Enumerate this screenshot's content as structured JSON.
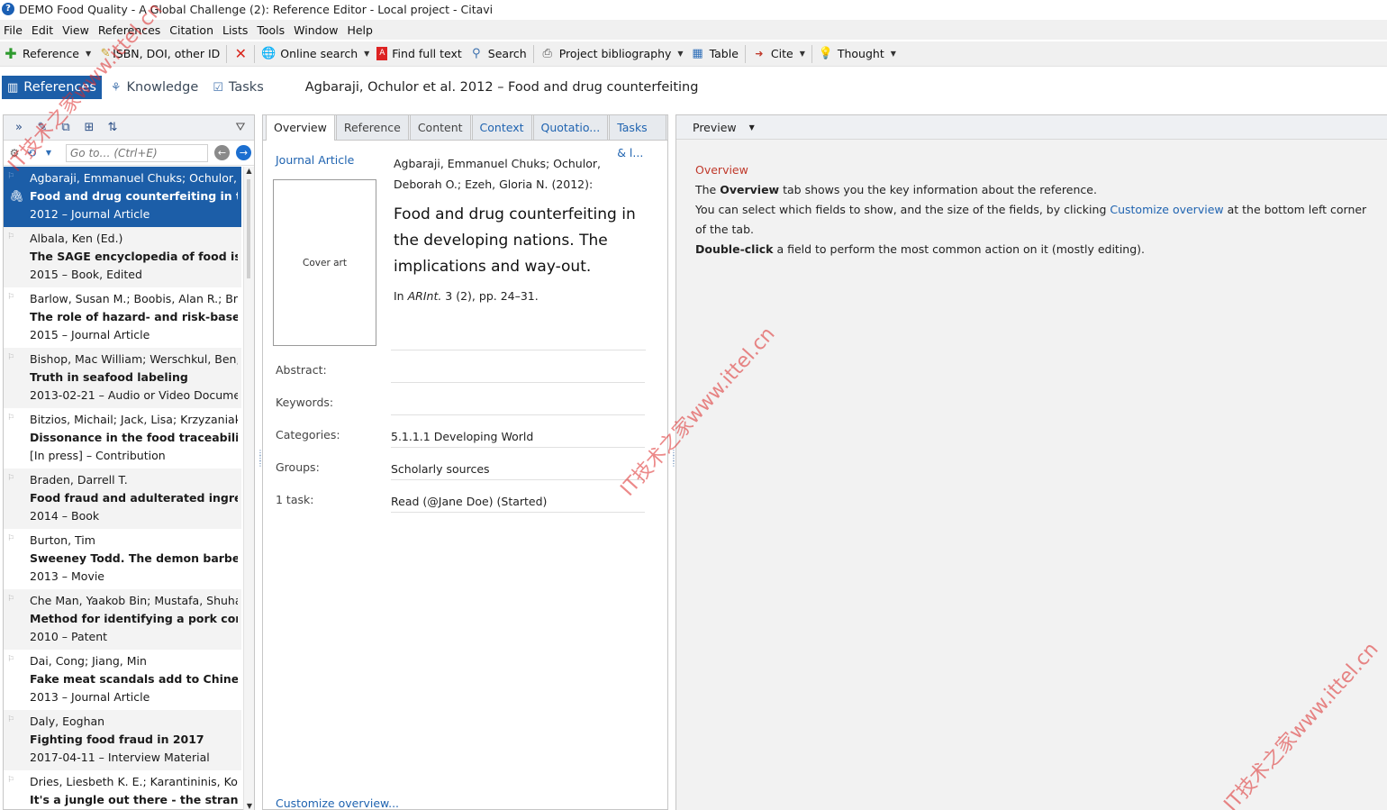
{
  "window": {
    "title": "DEMO Food Quality - A Global Challenge (2): Reference Editor - Local project - Citavi"
  },
  "menu": [
    "File",
    "Edit",
    "View",
    "References",
    "Citation",
    "Lists",
    "Tools",
    "Window",
    "Help"
  ],
  "toolbar": {
    "reference_label": "Reference",
    "isbn_label": "ISBN, DOI, other ID",
    "online_search_label": "Online search",
    "find_full_text_label": "Find full text",
    "search_label": "Search",
    "project_bibliography_label": "Project bibliography",
    "table_label": "Table",
    "cite_label": "Cite",
    "thought_label": "Thought"
  },
  "nav": {
    "references_label": "References",
    "knowledge_label": "Knowledge",
    "tasks_label": "Tasks",
    "current_title": "Agbaraji, Ochulor et al. 2012 – Food and drug counterfeiting"
  },
  "left": {
    "goto_placeholder": "Go to… (Ctrl+E)",
    "references": [
      {
        "authors": "Agbaraji, Emmanuel Chuks; Ochulor, D",
        "title": "Food and drug counterfeiting in the d",
        "meta": "2012 – Journal Article",
        "selected": true
      },
      {
        "authors": "Albala, Ken (Ed.)",
        "title": "The SAGE encyclopedia of food issues",
        "meta": "2015 – Book, Edited"
      },
      {
        "authors": "Barlow, Susan M.; Boobis, Alan R.; Brid",
        "title": "The role of hazard- and risk-based ap",
        "meta": "2015 – Journal Article"
      },
      {
        "authors": "Bishop, Mac William; Werschkul, Ben;",
        "title": "Truth in seafood labeling",
        "meta": "2013-02-21 – Audio or Video Docume"
      },
      {
        "authors": "Bitzios, Michail; Jack, Lisa; Krzyzaniak, S",
        "title": "Dissonance in the food traceability re",
        "meta": "[In press] – Contribution"
      },
      {
        "authors": "Braden, Darrell T.",
        "title": "Food fraud and adulterated ingredien",
        "meta": "2014 – Book"
      },
      {
        "authors": "Burton, Tim",
        "title": "Sweeney Todd. The demon barber of",
        "meta": "2013 – Movie"
      },
      {
        "authors": "Che Man, Yaakob Bin; Mustafa, Shuhai",
        "title": "Method for identifying a pork content",
        "meta": "2010 – Patent"
      },
      {
        "authors": "Dai, Cong; Jiang, Min",
        "title": "Fake meat scandals add to Chinese fo",
        "meta": "2013 – Journal Article"
      },
      {
        "authors": "Daly, Eoghan",
        "title": "Fighting food fraud in 2017",
        "meta": "2017-04-11 – Interview Material"
      },
      {
        "authors": "Dries, Liesbeth K. E.; Karantininis, Konst",
        "title": "It's a jungle out there - the strange ani",
        "meta": ""
      }
    ]
  },
  "middle": {
    "tabs": [
      "Overview",
      "Reference",
      "Content",
      "Context",
      "Quotatio...",
      "Tasks & l..."
    ],
    "ref_type": "Journal Article",
    "cover_art": "Cover art",
    "authors": "Agbaraji, Emmanuel Chuks; Ochulor, Deborah O.; Ezeh, Gloria N. (2012):",
    "title": "Food and drug counterfeiting in the developing nations. The implications and way-out.",
    "source_prefix": "In ",
    "source_journal": "ARInt.",
    "source_rest": " 3 (2), pp. 24–31.",
    "fields": [
      {
        "label": "Abstract:",
        "value": ""
      },
      {
        "label": "Keywords:",
        "value": ""
      },
      {
        "label": "Categories:",
        "value": "5.1.1.1 Developing World"
      },
      {
        "label": "Groups:",
        "value": "Scholarly sources"
      },
      {
        "label": "1 task:",
        "value": "Read (@Jane Doe) (Started)"
      }
    ],
    "customize_link": "Customize overview..."
  },
  "preview": {
    "header": "Preview",
    "heading": "Overview",
    "line1_a": "The ",
    "line1_b": "Overview",
    "line1_c": " tab shows you the key information about the reference.",
    "line2_a": "You can select which fields to show, and the size of the fields, by clicking ",
    "line2_link": "Customize overview",
    "line2_c": " at the bottom left corner of the tab.",
    "line3_a": "Double-click",
    "line3_c": " a field to perform the most common action on it (mostly editing)."
  },
  "watermark": "IT技术之家www.ittel.cn"
}
